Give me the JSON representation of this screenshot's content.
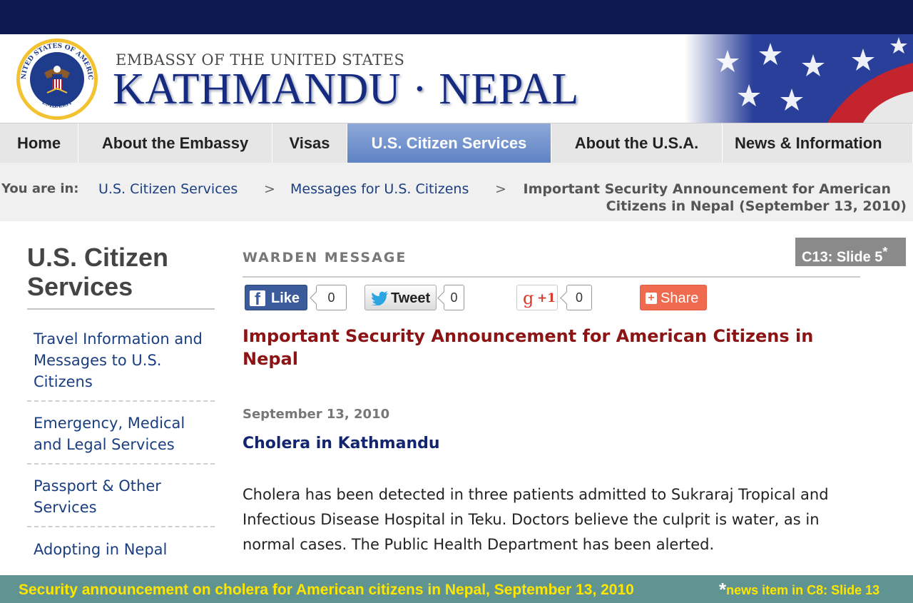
{
  "banner": {
    "sup_title": "EMBASSY OF THE UNITED STATES",
    "main_title": "KATHMANDU · NEPAL",
    "seal_text_top": "UNITED STATES OF AMERICA",
    "seal_text_bottom": "EMBASSY"
  },
  "nav": {
    "tabs": [
      {
        "label": "Home"
      },
      {
        "label": "About the Embassy"
      },
      {
        "label": "Visas"
      },
      {
        "label": "U.S. Citizen Services",
        "active": true
      },
      {
        "label": "About the U.S.A."
      },
      {
        "label": "News & Information"
      }
    ]
  },
  "breadcrumb": {
    "prefix": "You are in:",
    "items": [
      "U.S. Citizen Services",
      "Messages for U.S. Citizens"
    ],
    "separator": ">",
    "current_line1": "Important Security Announcement for American",
    "current_line2": "Citizens in Nepal (September 13, 2010)"
  },
  "slide_tag": {
    "label": "C13: Slide 5",
    "mark": "*"
  },
  "sidebar": {
    "heading_line1": "U.S. Citizen",
    "heading_line2": "Services",
    "items": [
      {
        "label": "Travel Information and Messages to U.S. Citizens"
      },
      {
        "label": "Emergency, Medical and Legal Services"
      },
      {
        "label": "Passport & Other Services"
      },
      {
        "label": "Adopting in Nepal"
      }
    ]
  },
  "article": {
    "section_label": "WARDEN MESSAGE",
    "social": {
      "like_label": "Like",
      "like_count": "0",
      "tweet_label": "Tweet",
      "tweet_count": "0",
      "gplus_label": "+1",
      "gplus_count": "0",
      "share_label": "Share"
    },
    "title": "Important Security Announcement for American Citizens in Nepal",
    "date": "September 13, 2010",
    "heading": "Cholera in Kathmandu",
    "body": "Cholera has been detected in three patients admitted to Sukraraj Tropical and Infectious Disease Hospital in Teku. Doctors believe the culprit is water, as in normal cases. The Public Health Department has been alerted."
  },
  "footer": {
    "caption": "Security announcement on cholera for American citizens in Nepal, September 13, 2010",
    "footnote_mark": "*",
    "footnote": "news item in C8: Slide 13"
  },
  "colors": {
    "top_bar": "#0d1a52",
    "title_blue": "#162a80",
    "active_tab": "#6f8fcc",
    "article_title": "#8c1414",
    "caption_bar": "#5f9492",
    "caption_text": "#ffe600"
  }
}
